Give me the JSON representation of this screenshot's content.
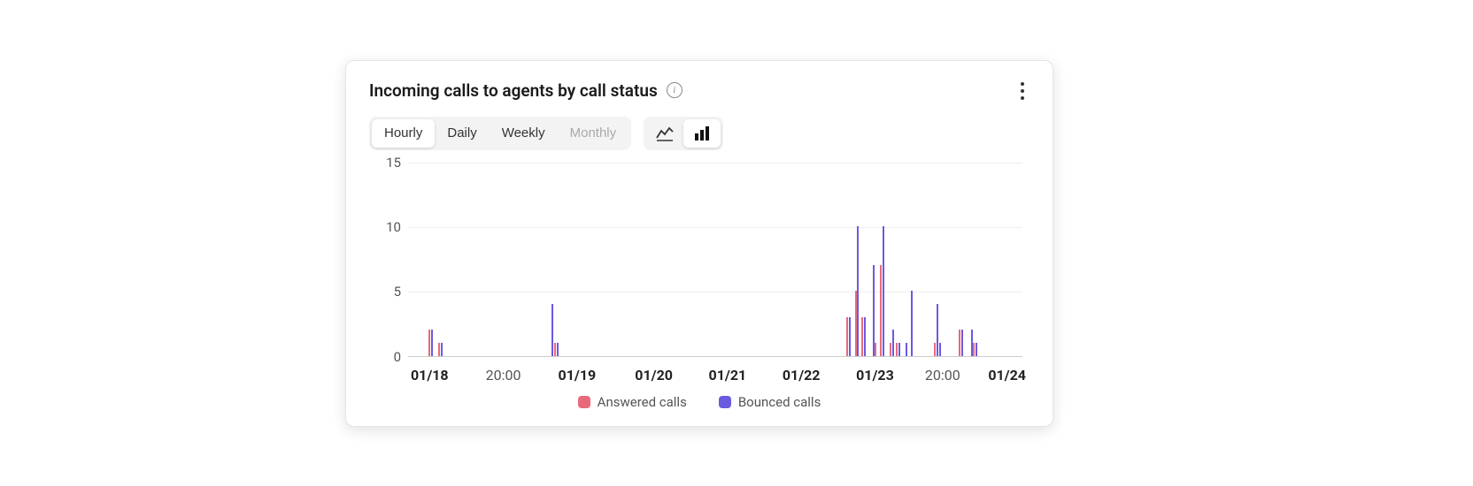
{
  "card": {
    "title": "Incoming calls to agents by call status"
  },
  "timeframe": {
    "options": [
      "Hourly",
      "Daily",
      "Weekly",
      "Monthly"
    ],
    "active": "Hourly",
    "disabled": [
      "Monthly"
    ]
  },
  "chartType": {
    "active": "bar"
  },
  "legend": {
    "series1": "Answered calls",
    "series2": "Bounced calls"
  },
  "colors": {
    "answered": "#e86a7a",
    "bounced": "#6a5ae0"
  },
  "chart_data": {
    "type": "bar",
    "title": "Incoming calls to agents by call status",
    "ylabel": "",
    "xlabel": "",
    "ylim": [
      0,
      15
    ],
    "yticks": [
      0,
      5,
      10,
      15
    ],
    "xticks": [
      {
        "label": "01/18",
        "pos": 0.035,
        "major": true
      },
      {
        "label": "20:00",
        "pos": 0.155,
        "major": false
      },
      {
        "label": "01/19",
        "pos": 0.275,
        "major": true
      },
      {
        "label": "01/20",
        "pos": 0.4,
        "major": true
      },
      {
        "label": "01/21",
        "pos": 0.52,
        "major": true
      },
      {
        "label": "01/22",
        "pos": 0.64,
        "major": true
      },
      {
        "label": "01/23",
        "pos": 0.76,
        "major": true
      },
      {
        "label": "20:00",
        "pos": 0.87,
        "major": false
      },
      {
        "label": "01/24",
        "pos": 0.975,
        "major": true
      }
    ],
    "series": [
      {
        "name": "Answered calls",
        "color": "#e86a7a",
        "points": [
          {
            "x": 0.033,
            "y": 2
          },
          {
            "x": 0.049,
            "y": 1
          },
          {
            "x": 0.238,
            "y": 1
          },
          {
            "x": 0.713,
            "y": 3
          },
          {
            "x": 0.727,
            "y": 5
          },
          {
            "x": 0.738,
            "y": 3
          },
          {
            "x": 0.76,
            "y": 1
          },
          {
            "x": 0.768,
            "y": 7
          },
          {
            "x": 0.784,
            "y": 1
          },
          {
            "x": 0.794,
            "y": 1
          },
          {
            "x": 0.856,
            "y": 1
          },
          {
            "x": 0.896,
            "y": 2
          },
          {
            "x": 0.92,
            "y": 1
          }
        ]
      },
      {
        "name": "Bounced calls",
        "color": "#6a5ae0",
        "points": [
          {
            "x": 0.037,
            "y": 2
          },
          {
            "x": 0.053,
            "y": 1
          },
          {
            "x": 0.234,
            "y": 4
          },
          {
            "x": 0.242,
            "y": 1
          },
          {
            "x": 0.717,
            "y": 3
          },
          {
            "x": 0.731,
            "y": 10
          },
          {
            "x": 0.742,
            "y": 3
          },
          {
            "x": 0.756,
            "y": 7
          },
          {
            "x": 0.772,
            "y": 10
          },
          {
            "x": 0.788,
            "y": 2
          },
          {
            "x": 0.798,
            "y": 1
          },
          {
            "x": 0.81,
            "y": 1
          },
          {
            "x": 0.818,
            "y": 5
          },
          {
            "x": 0.86,
            "y": 4
          },
          {
            "x": 0.864,
            "y": 1
          },
          {
            "x": 0.9,
            "y": 2
          },
          {
            "x": 0.916,
            "y": 2
          },
          {
            "x": 0.924,
            "y": 1
          }
        ]
      }
    ]
  }
}
